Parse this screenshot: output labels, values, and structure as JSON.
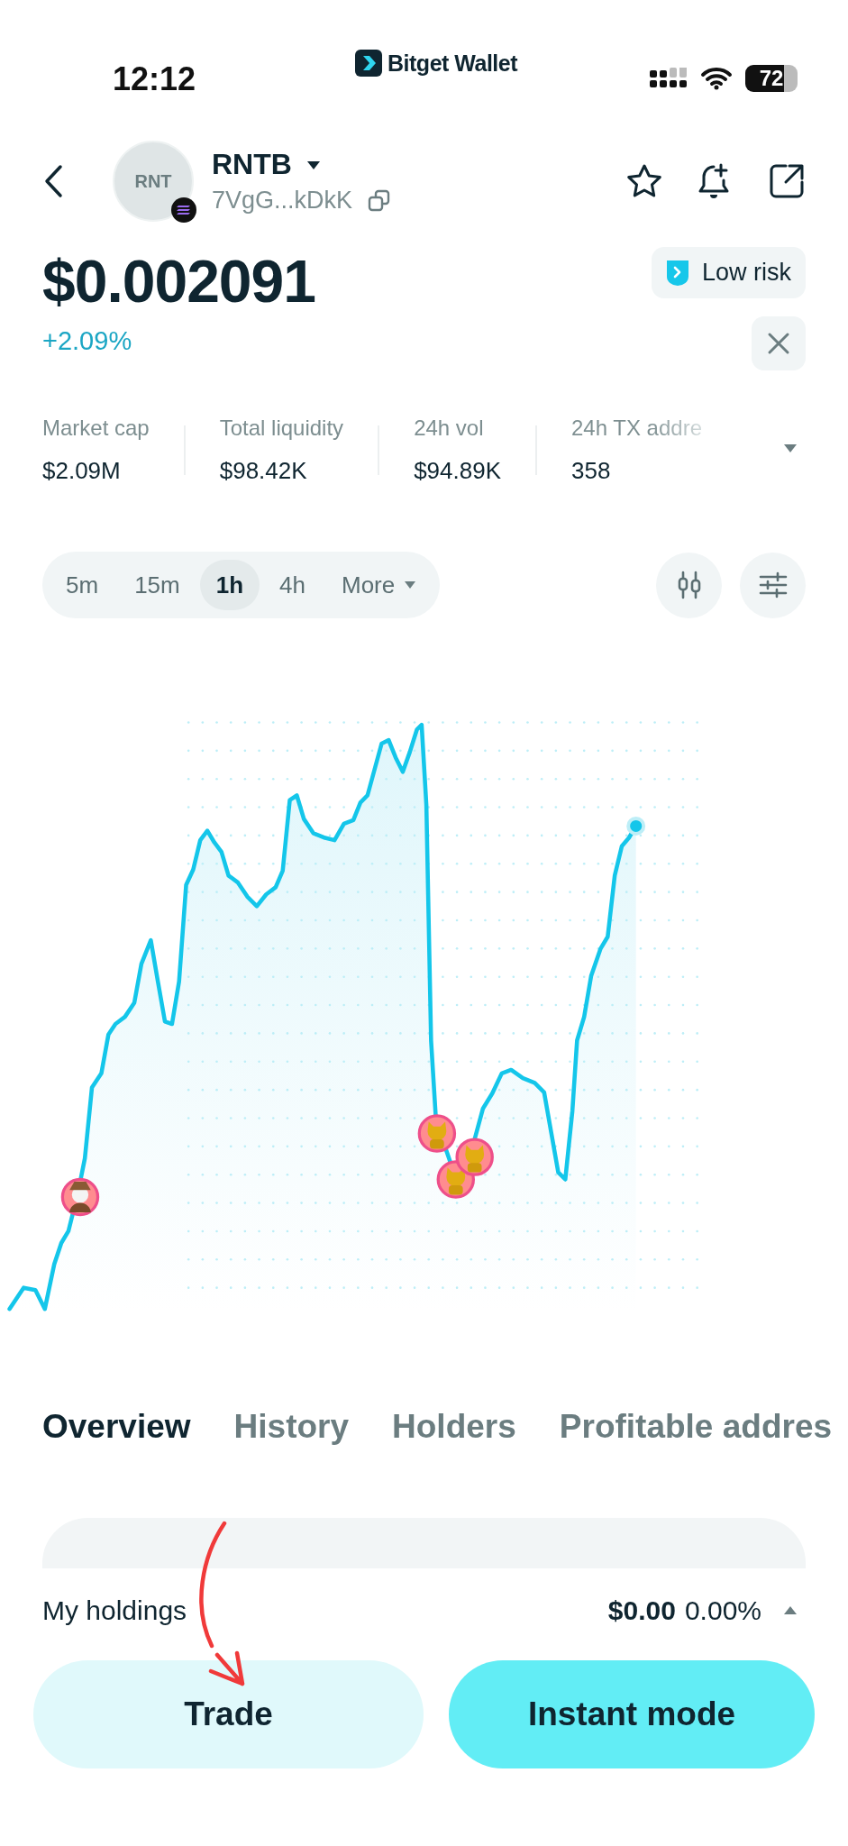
{
  "status_bar": {
    "time": "12:12",
    "app_name": "Bitget Wallet",
    "battery": "72"
  },
  "token": {
    "avatar_text": "RNT",
    "symbol": "RNTB",
    "address": "7VgG...kDkK",
    "price": "$0.002091",
    "change": "+2.09%",
    "risk": "Low risk"
  },
  "stats": [
    {
      "label": "Market cap",
      "value": "$2.09M"
    },
    {
      "label": "Total liquidity",
      "value": "$98.42K"
    },
    {
      "label": "24h vol",
      "value": "$94.89K"
    },
    {
      "label": "24h TX addre",
      "value": "358"
    }
  ],
  "intervals": [
    {
      "label": "5m",
      "selected": false,
      "kind": "option"
    },
    {
      "label": "15m",
      "selected": false,
      "kind": "option"
    },
    {
      "label": "1h",
      "selected": true,
      "kind": "option"
    },
    {
      "label": "4h",
      "selected": false,
      "kind": "option"
    },
    {
      "label": "More",
      "selected": false,
      "kind": "dropdown"
    }
  ],
  "tabs": [
    {
      "label": "Overview",
      "selected": true
    },
    {
      "label": "History",
      "selected": false
    },
    {
      "label": "Holders",
      "selected": false
    },
    {
      "label": "Profitable addres",
      "selected": false
    }
  ],
  "holdings": {
    "label": "My holdings",
    "value": "$0.00",
    "change": "0.00%"
  },
  "buttons": [
    {
      "label": "Trade",
      "kind": "secondary"
    },
    {
      "label": "Instant mode",
      "kind": "primary"
    }
  ]
}
